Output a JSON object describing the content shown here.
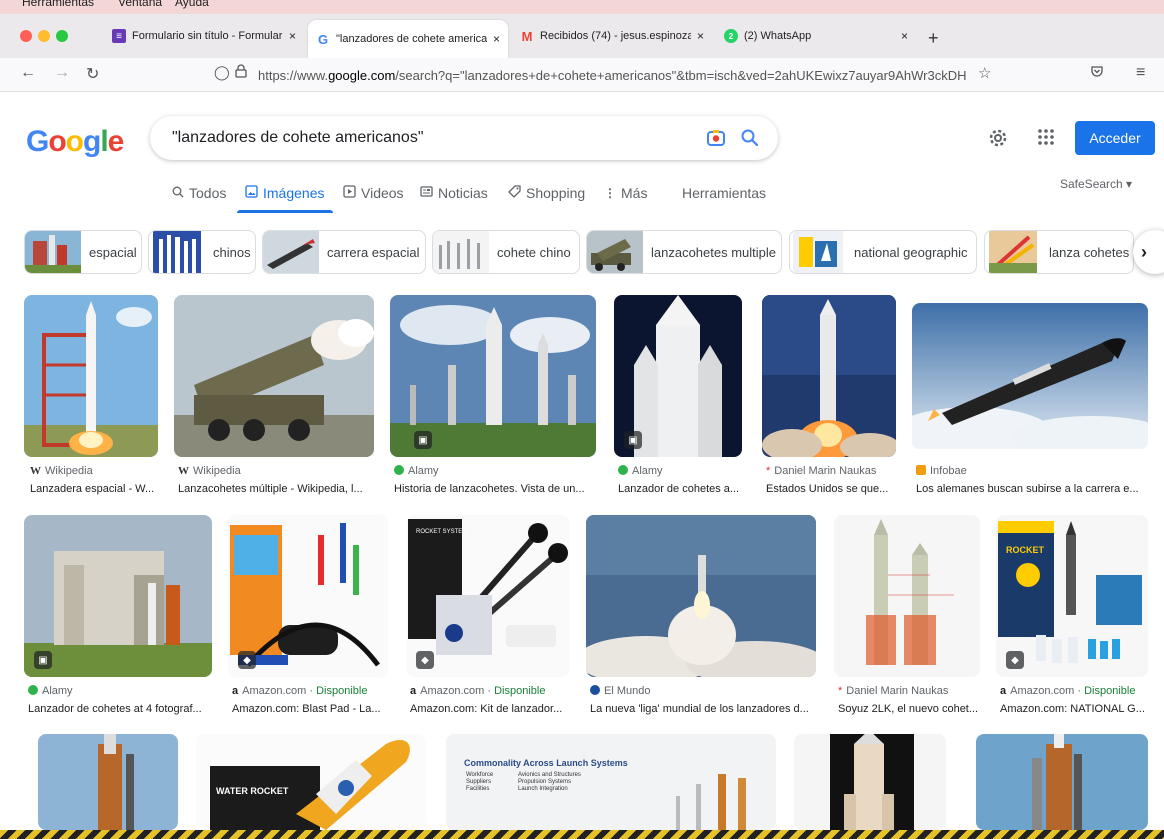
{
  "menubar": {
    "items": [
      "Herramientas",
      "Ventana",
      "Ayuda"
    ]
  },
  "browser": {
    "tabs": [
      {
        "title": "Formulario sin título - Formulari",
        "icon": "forms-icon",
        "color": "#673ab7"
      },
      {
        "title": "\"lanzadores de cohete american",
        "icon": "google-g-icon",
        "color": "#4285f4"
      },
      {
        "title": "Recibidos (74) - jesus.espinoza",
        "icon": "gmail-icon",
        "color": "#ea4335"
      },
      {
        "title": "(2) WhatsApp",
        "icon": "whatsapp-icon",
        "color": "#25d366"
      }
    ],
    "tab_close_glyph": "×",
    "new_tab_glyph": "+",
    "url_prefix": "https://www.",
    "url_domain": "google.com",
    "url_rest": "/search?q=\"lanzadores+de+cohete+americanos\"&tbm=isch&ved=2ahUKEwixz7auyar9AhWr3ckDH"
  },
  "google": {
    "logo": [
      "G",
      "o",
      "o",
      "g",
      "l",
      "e"
    ],
    "logo_colors": [
      "#4285f4",
      "#ea4335",
      "#fbbc05",
      "#4285f4",
      "#34a853",
      "#ea4335"
    ],
    "query": "\"lanzadores de cohete americanos\"",
    "signin_label": "Acceder",
    "safesearch_label": "SafeSearch ▾"
  },
  "filters": [
    {
      "label": "Todos",
      "icon": "search-icon"
    },
    {
      "label": "Imágenes",
      "icon": "image-icon",
      "active": true
    },
    {
      "label": "Videos",
      "icon": "video-icon"
    },
    {
      "label": "Noticias",
      "icon": "news-icon"
    },
    {
      "label": "Shopping",
      "icon": "tag-icon"
    },
    {
      "label": "Más",
      "icon": "more-vert-icon"
    },
    {
      "label": "Herramientas",
      "icon": ""
    }
  ],
  "chips": [
    {
      "label": "espacial"
    },
    {
      "label": "chinos"
    },
    {
      "label": "carrera espacial"
    },
    {
      "label": "cohete chino"
    },
    {
      "label": "lanzacohetes multiple"
    },
    {
      "label": "national geographic"
    },
    {
      "label": "lanza cohetes"
    }
  ],
  "results_row1": [
    {
      "source": "Wikipedia",
      "fav": "W",
      "caption": "Lanzadera espacial - W..."
    },
    {
      "source": "Wikipedia",
      "fav": "W",
      "caption": "Lanzacohetes múltiple - Wikipedia, l..."
    },
    {
      "source": "Alamy",
      "fav": "a",
      "caption": "Historia de lanzacohetes. Vista de un..."
    },
    {
      "source": "Alamy",
      "fav": "a",
      "caption": "Lanzador de cohetes a..."
    },
    {
      "source": "Daniel Marin Naukas",
      "fav": "*",
      "caption": "Estados Unidos se que..."
    },
    {
      "source": "Infobae",
      "fav": "i",
      "caption": "Los alemanes buscan subirse a la carrera e..."
    }
  ],
  "results_row2": [
    {
      "source": "Alamy",
      "fav": "a",
      "availability": "",
      "caption": "Lanzador de cohetes at 4 fotograf..."
    },
    {
      "source": "Amazon.com",
      "fav": "a",
      "availability": "Disponible",
      "caption": "Amazon.com: Blast Pad - La..."
    },
    {
      "source": "Amazon.com",
      "fav": "a",
      "availability": "Disponible",
      "caption": "Amazon.com: Kit de lanzador..."
    },
    {
      "source": "El Mundo",
      "fav": "e",
      "availability": "",
      "caption": "La nueva 'liga' mundial de los lanzadores d..."
    },
    {
      "source": "Daniel Marin Naukas",
      "fav": "*",
      "availability": "",
      "caption": "Soyuz 2LK, el nuevo cohet..."
    },
    {
      "source": "Amazon.com",
      "fav": "a",
      "availability": "Disponible",
      "caption": "Amazon.com: NATIONAL G..."
    }
  ],
  "row3_texts": {
    "water_rocket": "WATER ROCKET",
    "slide_title": "Commonality Across Launch Systems",
    "slide_col1": [
      "Workforce",
      "Suppliers",
      "Facilities"
    ],
    "slide_col2": [
      "Avionics and Structures",
      "Propulsion Systems",
      "Launch Integration"
    ],
    "rocket_system": "ROCKET SYSTEM",
    "rocket_box": "ROCKET",
    "source_sep": " · "
  }
}
